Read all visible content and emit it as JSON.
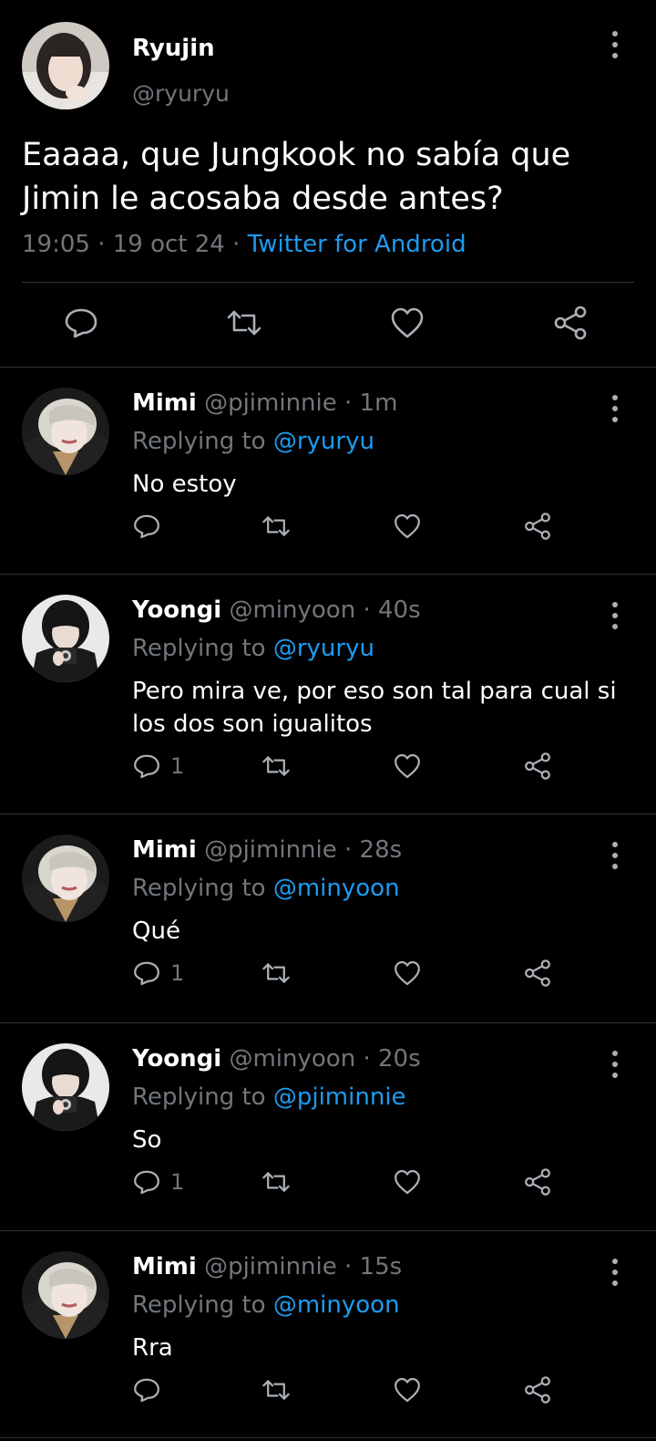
{
  "main_tweet": {
    "name": "Ryujin",
    "handle": "@ryuryu",
    "text": "Eaaaa, que Jungkook no sabía que Jimin le acosaba desde antes?",
    "time": "19:05",
    "date": "19 oct 24",
    "separator": "·",
    "source": "Twitter for Android",
    "icons": [
      "comment-icon",
      "retweet-icon",
      "heart-icon",
      "share-icon",
      "more-icon"
    ]
  },
  "replies": [
    {
      "name": "Mimi",
      "handle": "@pjiminnie",
      "time": "1m",
      "replying_prefix": "Replying to",
      "replying_to": "@ryuryu",
      "text": "No estoy",
      "reply_count": ""
    },
    {
      "name": "Yoongi",
      "handle": "@minyoon",
      "time": "40s",
      "replying_prefix": "Replying to",
      "replying_to": "@ryuryu",
      "text": "Pero mira ve, por eso son tal para cual si los dos son igualitos",
      "reply_count": "1"
    },
    {
      "name": "Mimi",
      "handle": "@pjiminnie",
      "time": "28s",
      "replying_prefix": "Replying to",
      "replying_to": "@minyoon",
      "text": "Qué",
      "reply_count": "1"
    },
    {
      "name": "Yoongi",
      "handle": "@minyoon",
      "time": "20s",
      "replying_prefix": "Replying to",
      "replying_to": "@pjiminnie",
      "text": "So",
      "reply_count": "1"
    },
    {
      "name": "Mimi",
      "handle": "@pjiminnie",
      "time": "15s",
      "replying_prefix": "Replying to",
      "replying_to": "@minyoon",
      "text": "Rra",
      "reply_count": ""
    }
  ],
  "colors": {
    "background": "#000000",
    "text": "#ffffff",
    "muted": "#71767b",
    "link": "#1d9bf0",
    "divider": "#2f3336"
  }
}
